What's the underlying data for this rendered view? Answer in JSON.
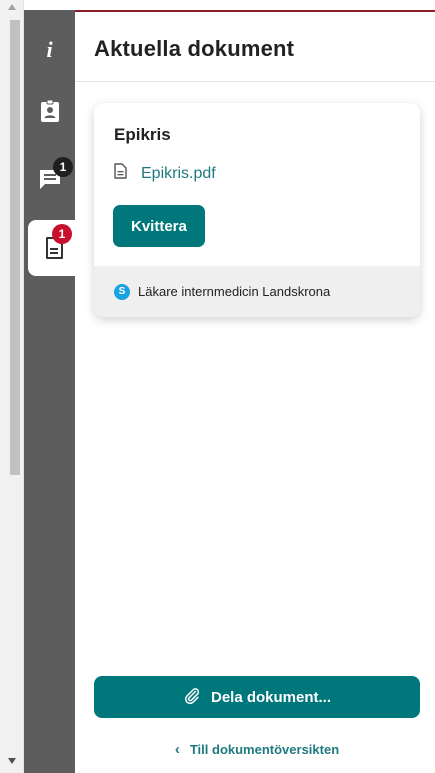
{
  "rail": {
    "items": [
      {
        "icon": "info-icon",
        "label": "i"
      },
      {
        "icon": "contact-card-icon"
      },
      {
        "icon": "messages-icon",
        "badge": "1"
      },
      {
        "icon": "document-icon",
        "badge": "1",
        "active": true
      }
    ]
  },
  "header": {
    "title": "Aktuella dokument"
  },
  "card": {
    "title": "Epikris",
    "file_name": "Epikris.pdf",
    "action_label": "Kvittera",
    "sender_initial": "S",
    "sender": "Läkare internmedicin Landskrona"
  },
  "share_button": {
    "label": "Dela dokument..."
  },
  "back_link": {
    "chevron": "‹",
    "label": "Till dokumentöversikten"
  },
  "colors": {
    "accent": "#00777b",
    "link": "#1f7a7f",
    "rail": "#5d5d5d",
    "badge_red": "#c8102e",
    "badge_dark": "#1f1f1f",
    "avatar": "#1aa3e0"
  }
}
